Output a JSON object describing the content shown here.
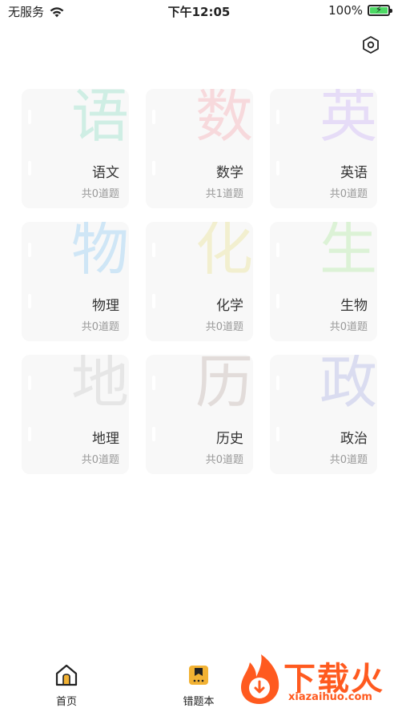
{
  "status_bar": {
    "carrier": "无服务",
    "time": "下午12:05",
    "battery": "100%"
  },
  "header": {
    "settings_icon": "hexagon-gear-icon"
  },
  "subjects": [
    {
      "watermark": "语",
      "name": "语文",
      "count": "共0道题",
      "color": "#cfeee4"
    },
    {
      "watermark": "数",
      "name": "数学",
      "count": "共1道题",
      "color": "#f7d9dc"
    },
    {
      "watermark": "英",
      "name": "英语",
      "count": "共0道题",
      "color": "#e6dcf7"
    },
    {
      "watermark": "物",
      "name": "物理",
      "count": "共0道题",
      "color": "#cfe6f6"
    },
    {
      "watermark": "化",
      "name": "化学",
      "count": "共0道题",
      "color": "#f2efcf"
    },
    {
      "watermark": "生",
      "name": "生物",
      "count": "共0道题",
      "color": "#dcf2d6"
    },
    {
      "watermark": "地",
      "name": "地理",
      "count": "共0道题",
      "color": "#e6e6e6"
    },
    {
      "watermark": "历",
      "name": "历史",
      "count": "共0道题",
      "color": "#e2dcda"
    },
    {
      "watermark": "政",
      "name": "政治",
      "count": "共0道题",
      "color": "#dadcf0"
    }
  ],
  "tab_bar": {
    "home_label": "首页",
    "wrong_book_label": "错题本"
  },
  "brand": {
    "name": "下载火",
    "url": "xiazaihuo.com"
  }
}
